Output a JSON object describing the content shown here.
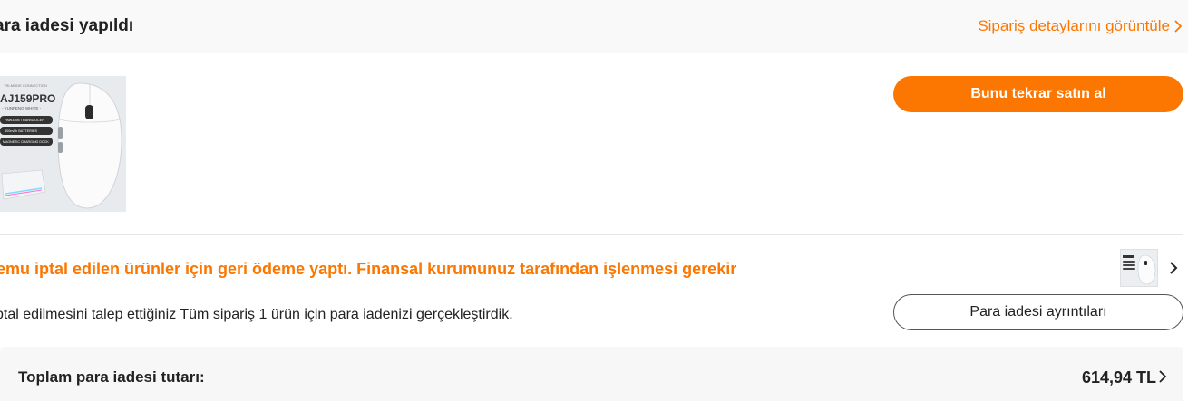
{
  "header": {
    "title": "ara iadesi yapıldı",
    "details_link": "Sipariş detaylarını görüntüle"
  },
  "product": {
    "image_icon": "wireless-mouse-product-image",
    "image_text": {
      "connection": "TRI-MODE CONNECTION",
      "model": "AJ159PRO",
      "color": "- YUNFENG WHITE -",
      "feature_1": "PAW3395 TRANSDUCER",
      "feature_2": "400mAh BATTERIES",
      "feature_3": "MAGNETIC CHARGING DOCK"
    }
  },
  "actions": {
    "buy_again": "Bunu tekrar satın al",
    "refund_details": "Para iadesi ayrıntıları"
  },
  "refund": {
    "headline": "emu iptal edilen ürünler için geri ödeme yaptı. Finansal kurumunuz tarafından işlenmesi gerekir",
    "description": "ptal edilmesini talep ettiğiniz Tüm sipariş 1 ürün için para iadenizi gerçekleştirdik."
  },
  "total": {
    "label": "Toplam para iadesi tutarı:",
    "amount": "614,94 TL"
  },
  "colors": {
    "accent": "#fb7701",
    "text": "#222222",
    "background": "#ffffff"
  }
}
